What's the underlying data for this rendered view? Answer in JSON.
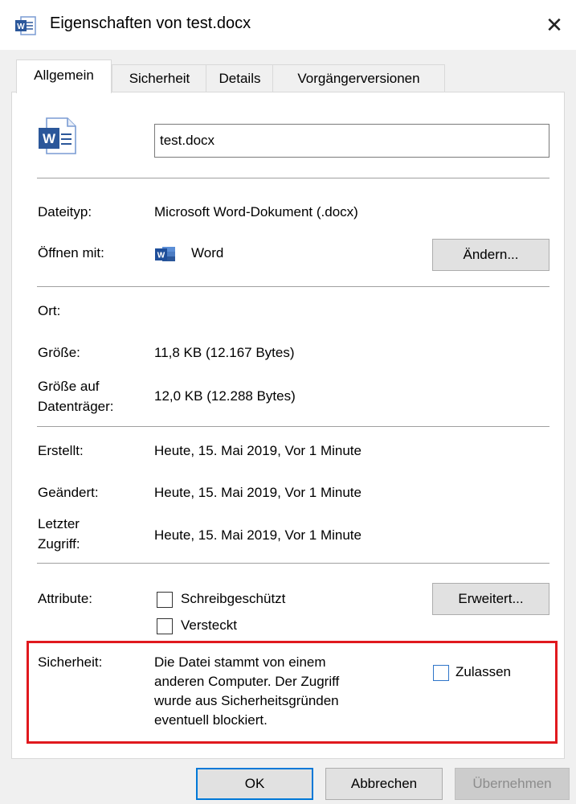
{
  "window": {
    "title": "Eigenschaften von test.docx",
    "close_glyph": "✕",
    "app_icon": "word-document-icon"
  },
  "tabs": [
    {
      "label": "Allgemein",
      "active": true
    },
    {
      "label": "Sicherheit",
      "active": false
    },
    {
      "label": "Details",
      "active": false
    },
    {
      "label": "Vorgängerversionen",
      "active": false
    }
  ],
  "general": {
    "file_icon": "word-document-icon",
    "filename": "test.docx",
    "filetype_label": "Dateityp:",
    "filetype_value": "Microsoft Word-Dokument (.docx)",
    "openwith_label": "Öffnen mit:",
    "openwith_value": "Word",
    "openwith_icon": "word-app-icon",
    "change_button": "Ändern...",
    "location_label": "Ort:",
    "location_value": "",
    "size_label": "Größe:",
    "size_value": "11,8 KB (12.167 Bytes)",
    "disksize_label_1": "Größe auf",
    "disksize_label_2": "Datenträger:",
    "disksize_value": "12,0 KB (12.288 Bytes)",
    "created_label": "Erstellt:",
    "created_value": "Heute, 15. Mai 2019, Vor 1 Minute",
    "modified_label": "Geändert:",
    "modified_value": "Heute, 15. Mai 2019, Vor 1 Minute",
    "accessed_label_1": "Letzter",
    "accessed_label_2": "Zugriff:",
    "accessed_value": "Heute, 15. Mai 2019, Vor 1 Minute",
    "attributes_label": "Attribute:",
    "readonly_label": "Schreibgeschützt",
    "readonly_checked": false,
    "hidden_label": "Versteckt",
    "hidden_checked": false,
    "advanced_button": "Erweitert...",
    "security_label": "Sicherheit:",
    "security_text_1": "Die Datei stammt von einem",
    "security_text_2": "anderen Computer. Der Zugriff",
    "security_text_3": "wurde aus Sicherheitsgründen",
    "security_text_4": "eventuell blockiert.",
    "unblock_label": "Zulassen",
    "unblock_checked": false
  },
  "footer": {
    "ok_button": "OK",
    "cancel_button": "Abbrechen",
    "apply_button": "Übernehmen"
  },
  "colors": {
    "highlight_border": "#e0191e",
    "word_blue": "#2b579a",
    "default_button_border": "#0078d7"
  }
}
